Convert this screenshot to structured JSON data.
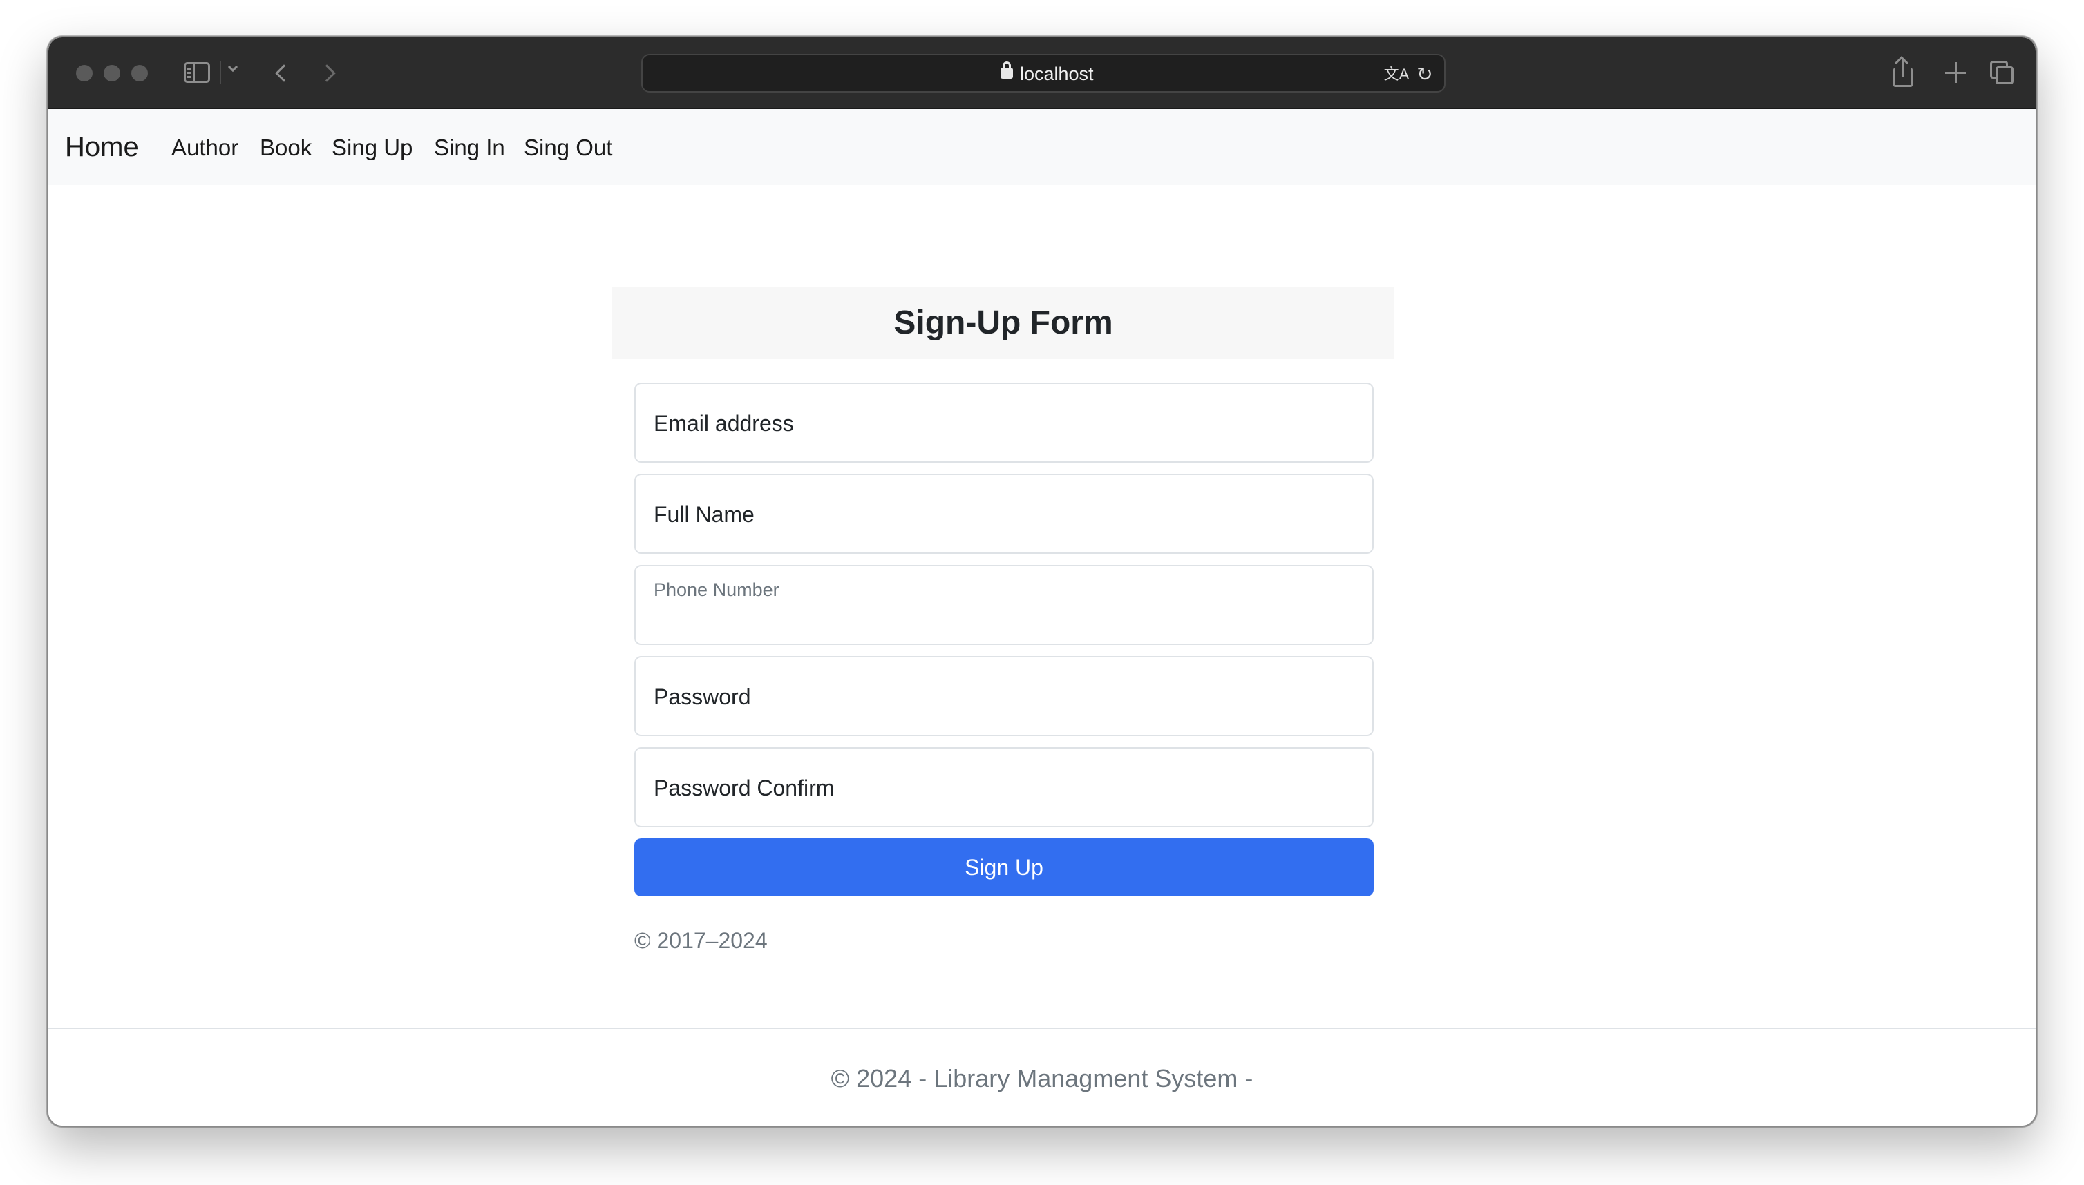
{
  "browser": {
    "url": "localhost",
    "icons": [
      "close-icon",
      "minimize-icon",
      "maximize-icon",
      "sidebar-icon",
      "chevron-down-icon",
      "back-icon",
      "forward-icon",
      "lock-icon",
      "translate-icon",
      "reload-icon",
      "share-icon",
      "new-tab-icon",
      "tab-overview-icon"
    ]
  },
  "navbar": {
    "brand": "Home",
    "links": {
      "author": "Author",
      "book": "Book",
      "signup": "Sing Up",
      "signin": "Sing In",
      "signout": "Sing Out"
    }
  },
  "form": {
    "title": "Sign-Up Form",
    "fields": {
      "email": "Email address",
      "full_name": "Full Name",
      "phone": "Phone Number",
      "password": "Password",
      "password_confirm": "Password Confirm"
    },
    "submit_label": "Sign Up",
    "accent_color": "#326ef0"
  },
  "inner_copyright": "© 2017–2024",
  "footer": {
    "text": "© 2024 - Library Managment System -"
  }
}
